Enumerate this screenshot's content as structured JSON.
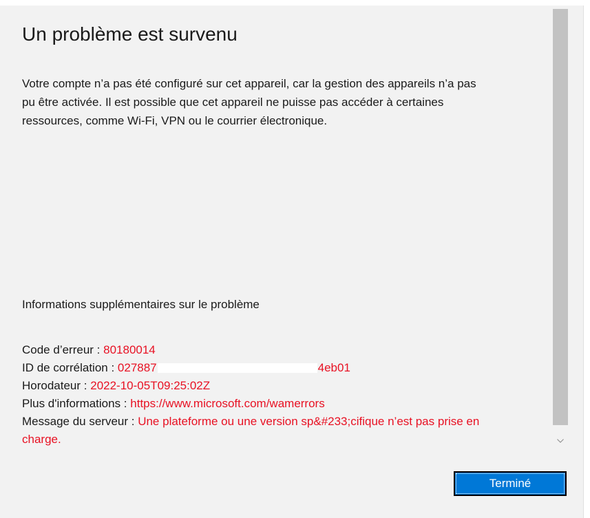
{
  "dialog": {
    "title": "Un problème est survenu",
    "message_lines": [
      "Votre compte n’a pas été configuré sur cet appareil, car la gestion des appareils n’a pas",
      "pu être activée. Il est possible que cet appareil ne puisse pas accéder à certaines",
      "ressources, comme Wi-Fi, VPN ou le courrier électronique."
    ],
    "more_info_heading": "Informations supplémentaires sur le problème",
    "details": {
      "error_code": {
        "label": "Code d’erreur : ",
        "value": "80180014"
      },
      "correlation_id": {
        "label": "ID de corrélation : ",
        "value_start": "027887",
        "value_end": "4eb01"
      },
      "timestamp": {
        "label": "Horodateur : ",
        "value": "2022-10-05T09:25:02Z"
      },
      "more_info": {
        "label": "Plus d'informations : ",
        "value": "https://www.microsoft.com/wamerrors"
      },
      "server_message": {
        "label": "Message du serveur : ",
        "value_line1": "Une plateforme ou une version sp&#233;cifique n’est pas prise en",
        "value_line2": "charge."
      }
    },
    "done_button_label": "Terminé"
  },
  "colors": {
    "background": "#f2f2f2",
    "error_text": "#e81123",
    "button_accent": "#0078d7",
    "scrollbar_thumb": "#c2c2c2"
  },
  "icons": {
    "scroll_down": "chevron-down-icon"
  }
}
